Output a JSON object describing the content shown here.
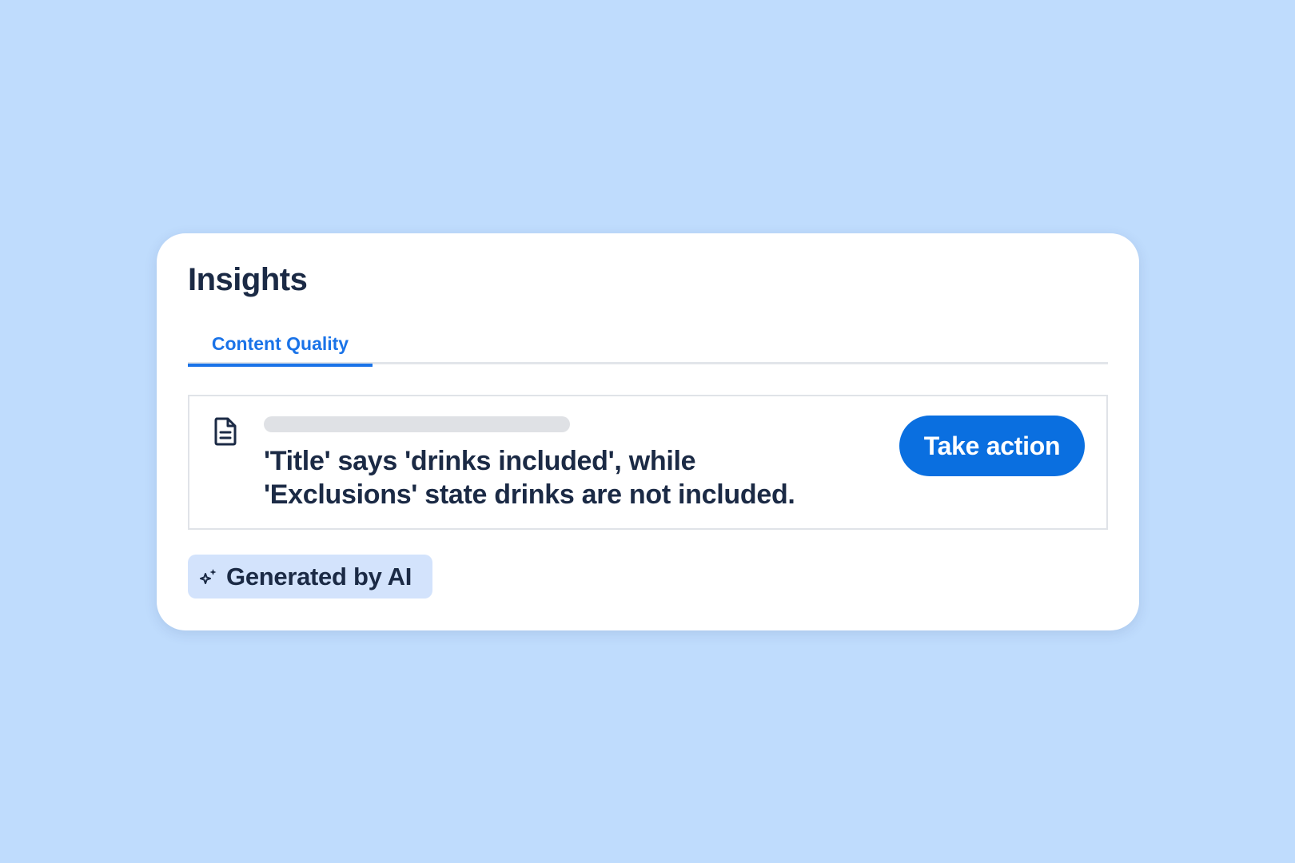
{
  "colors": {
    "background": "#bfdcfd",
    "accent": "#1a73e8",
    "button": "#0a6fe0",
    "text": "#1b2a45",
    "badge": "#d3e3fc"
  },
  "header": {
    "title": "Insights"
  },
  "tabs": [
    {
      "label": "Content Quality",
      "active": true
    }
  ],
  "insight": {
    "icon": "document-icon",
    "message": "'Title' says 'drinks included', while 'Exclusions' state drinks are not included.",
    "action_label": "Take action"
  },
  "ai_badge": {
    "icon": "sparkle-icon",
    "label": "Generated by AI"
  }
}
